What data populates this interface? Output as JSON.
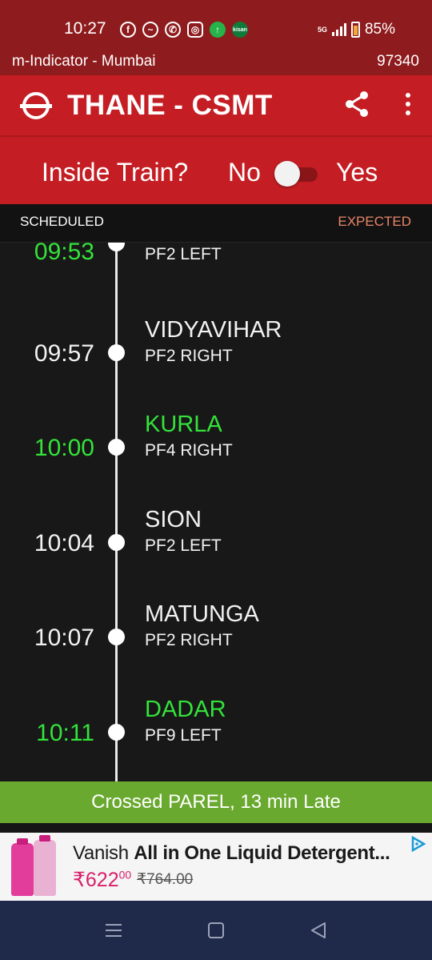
{
  "status_bar": {
    "time": "10:27",
    "network": "5G",
    "battery": "85%",
    "notification_icons": [
      "facebook-icon",
      "messenger-icon",
      "whatsapp-icon",
      "instagram-icon",
      "upload-icon",
      "kisan-app-icon"
    ]
  },
  "app": {
    "name": "m-Indicator - Mumbai",
    "code": "97340"
  },
  "toolbar": {
    "title": "THANE - CSMT",
    "accent_color": "#c41e24"
  },
  "inside_train": {
    "question": "Inside Train?",
    "no_label": "No",
    "yes_label": "Yes",
    "toggle_on": false
  },
  "columns": {
    "scheduled": "SCHEDULED",
    "expected": "EXPECTED"
  },
  "stops": [
    {
      "time": "09:53",
      "station": "",
      "platform": "PF2 LEFT",
      "highlight": true
    },
    {
      "time": "09:57",
      "station": "VIDYAVIHAR",
      "platform": "PF2 RIGHT",
      "highlight": false
    },
    {
      "time": "10:00",
      "station": "KURLA",
      "platform": "PF4 RIGHT",
      "highlight": true
    },
    {
      "time": "10:04",
      "station": "SION",
      "platform": "PF2 LEFT",
      "highlight": false
    },
    {
      "time": "10:07",
      "station": "MATUNGA",
      "platform": "PF2 RIGHT",
      "highlight": false
    },
    {
      "time": "10:11",
      "station": "DADAR",
      "platform": "PF9 LEFT",
      "highlight": true
    }
  ],
  "status_message": "Crossed PAREL, 13 min Late",
  "ad": {
    "brand": "Vanish",
    "title_bold": "All in One Liquid Detergent...",
    "price": "₹622",
    "price_decimals": "00",
    "old_price": "₹764.00"
  }
}
